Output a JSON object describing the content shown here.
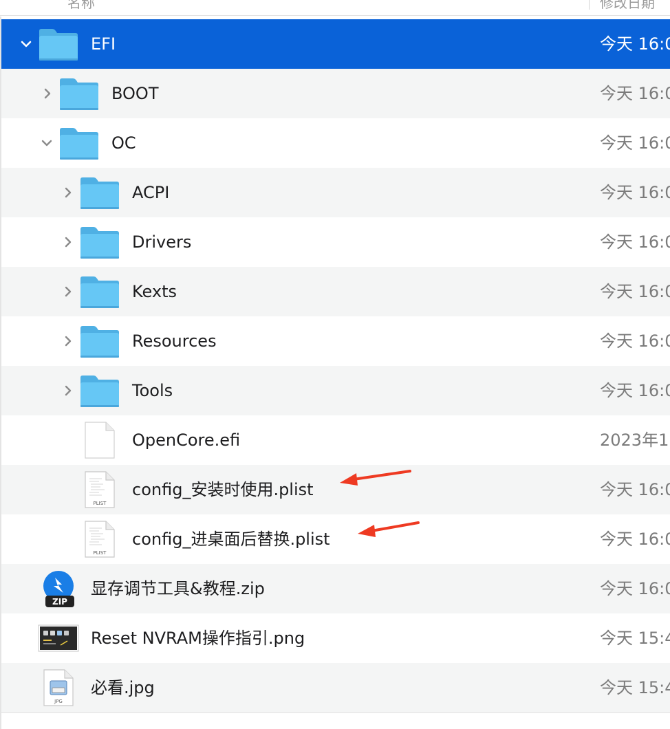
{
  "header": {
    "name_col": "名称",
    "date_col": "修改日期"
  },
  "rows": [
    {
      "name": "EFI",
      "date": "今天 16:0"
    },
    {
      "name": "BOOT",
      "date": "今天 16:0"
    },
    {
      "name": "OC",
      "date": "今天 16:0"
    },
    {
      "name": "ACPI",
      "date": "今天 16:0"
    },
    {
      "name": "Drivers",
      "date": "今天 16:0"
    },
    {
      "name": "Kexts",
      "date": "今天 16:0"
    },
    {
      "name": "Resources",
      "date": "今天 16:0"
    },
    {
      "name": "Tools",
      "date": "今天 16:0"
    },
    {
      "name": "OpenCore.efi",
      "date": "2023年1"
    },
    {
      "name": "config_安装时使用.plist",
      "date": "今天 16:0",
      "badge": "PLIST"
    },
    {
      "name": "config_进桌面后替换.plist",
      "date": "今天 16:0",
      "badge": "PLIST"
    },
    {
      "name": "显存调节工具&教程.zip",
      "date": "今天 16:0",
      "badge": "ZIP"
    },
    {
      "name": "Reset NVRAM操作指引.png",
      "date": "今天 15:4"
    },
    {
      "name": "必看.jpg",
      "date": "今天 15:4",
      "badge": "JPG"
    }
  ],
  "colors": {
    "selection": "#0a62d8",
    "folder": "#5ec4f3",
    "annotation_arrow": "#ee3a22"
  },
  "icons": {
    "folder": "folder-icon",
    "document": "document-icon",
    "plist": "plist-file-icon",
    "zip": "zip-archive-icon",
    "png": "image-thumbnail-icon",
    "jpg": "jpg-file-icon"
  }
}
